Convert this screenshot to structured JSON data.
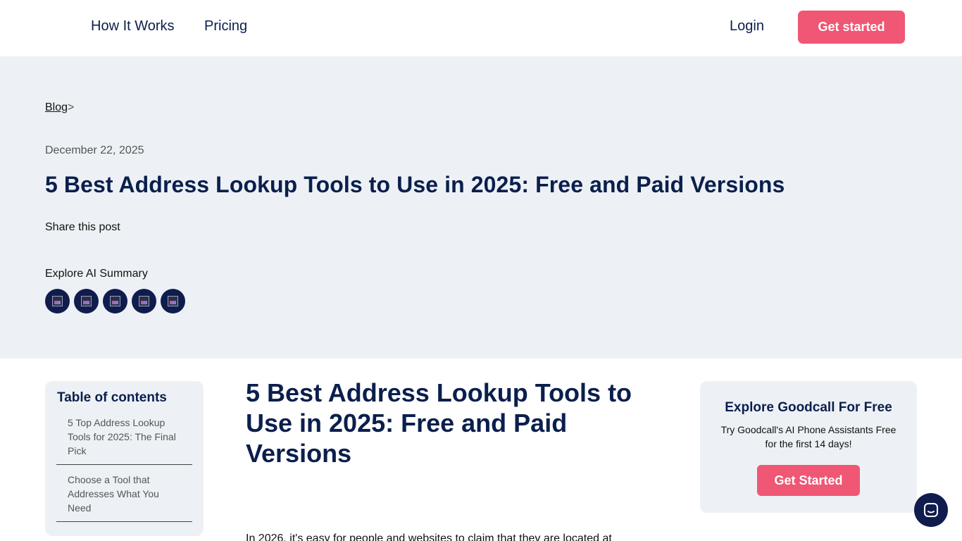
{
  "nav": {
    "how_it_works": "How It Works",
    "pricing": "Pricing",
    "login": "Login",
    "get_started": "Get started"
  },
  "hero": {
    "breadcrumb_blog": "Blog",
    "breadcrumb_sep": ">",
    "date": "December 22, 2025",
    "title": "5 Best Address Lookup Tools to Use in 2025: Free and Paid Versions",
    "share": "Share this post",
    "ai_summary": "Explore AI Summary",
    "ai_icons": [
      "ai-summary-icon",
      "ai-summary-icon",
      "ai-summary-icon",
      "ai-summary-icon",
      "ai-summary-icon"
    ]
  },
  "toc": {
    "title": "Table of contents",
    "items": [
      "5 Top Address Lookup Tools for 2025: The Final Pick",
      "Choose a Tool that Addresses What You Need"
    ]
  },
  "article": {
    "title": "5 Best Address Lookup Tools to Use in 2025: Free and Paid Versions",
    "intro": "In 2026, it's easy for people and websites to claim that they are located at"
  },
  "promo": {
    "title": "Explore Goodcall For Free",
    "text": "Try Goodcall's AI Phone Assistants Free for the first 14 days!",
    "button": "Get Started"
  },
  "colors": {
    "navy": "#0b1f4d",
    "accent": "#ef5774",
    "panel": "#edf1f5"
  }
}
